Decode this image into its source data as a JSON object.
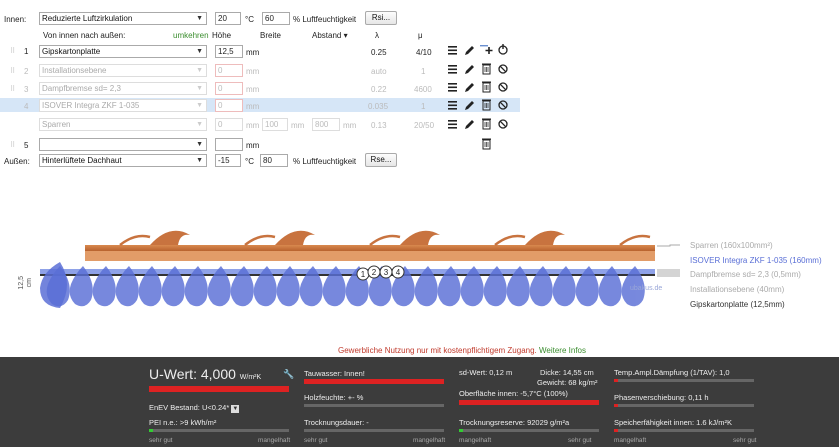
{
  "header": {
    "inside_label": "Innen:",
    "inside_climate": "Reduzierte Luftzirkulation",
    "inside_temp": "20",
    "temp_unit": "°C",
    "inside_humidity": "60",
    "humidity_label": "% Luftfeuchtigkeit",
    "rsi_button": "Rsi...",
    "order_label": "Von innen nach außen:",
    "reverse_link": "umkehren",
    "col_height": "Höhe",
    "col_width": "Breite",
    "col_spacing": "Abstand ▾",
    "col_lambda": "λ",
    "col_mu": "μ"
  },
  "layers": [
    {
      "num": "1",
      "material": "Gipskartonplatte",
      "height": "12,5",
      "unit": "mm",
      "lambda": "0.25",
      "mu": "4/10",
      "active": true
    },
    {
      "num": "2",
      "material": "Installationsebene",
      "height": "0",
      "unit": "mm",
      "lambda": "auto",
      "mu": "1",
      "active": false
    },
    {
      "num": "3",
      "material": "Dampfbremse sd= 2,3",
      "height": "0",
      "unit": "mm",
      "lambda": "0.22",
      "mu": "4600",
      "active": false
    },
    {
      "num": "4",
      "material": "ISOVER Integra ZKF 1-035",
      "height": "0",
      "unit": "mm",
      "lambda": "0.035",
      "mu": "1",
      "active": false
    },
    {
      "num": "",
      "material": "Sparren",
      "height": "0",
      "unit": "mm",
      "width": "100",
      "width_unit": "mm",
      "spacing": "800",
      "spacing_unit": "mm",
      "lambda": "0.13",
      "mu": "20/50",
      "active": false
    },
    {
      "num": "5",
      "material": "",
      "height": "",
      "unit": "mm",
      "lambda": "",
      "mu": "",
      "active": true
    }
  ],
  "outside": {
    "outside_label": "Außen:",
    "outside_climate": "Hinterlüftete Dachhaut",
    "outside_temp": "-15",
    "temp_unit": "°C",
    "outside_humidity": "80",
    "humidity_label": "% Luftfeuchtigkeit",
    "rse_button": "Rse..."
  },
  "diagram": {
    "scale_label": "12,5",
    "scale_unit": "cm",
    "markers": [
      "1",
      "2",
      "3",
      "4"
    ],
    "watermark": "ubakus.de",
    "legend": [
      {
        "text": "Sparren (160x100mm²)",
        "color": "#aaaaaa"
      },
      {
        "text": "ISOVER Integra ZKF 1-035 (160mm)",
        "color": "#5a6fd6"
      },
      {
        "text": "Dampfbremse sd= 2,3 (0,5mm)",
        "color": "#aaaaaa"
      },
      {
        "text": "Installationsebene (40mm)",
        "color": "#aaaaaa"
      },
      {
        "text": "Gipskartonplatte (12,5mm)",
        "color": "#333333"
      }
    ],
    "colors": {
      "roof": "#c8733f",
      "drop": "#5a6fd6",
      "accent": "#3a8d2e"
    }
  },
  "notice": {
    "text": "Gewerbliche Nutzung nur mit kostenpflichtigem Zugang.",
    "link": "Weitere Infos"
  },
  "results": {
    "uwert_label": "U-Wert:",
    "uwert_value": "4,000",
    "uwert_unit": "W/m²K",
    "enev_label": "EnEV Bestand: U<0.24*",
    "pei_label": "PEI n.e.: >9 kWh/m²",
    "scale_good": "sehr gut",
    "scale_bad": "mangelhaft",
    "tauwasser": "Tauwasser: Innen!",
    "holzfeuchte": "Holzfeuchte: +- %",
    "trocknungsdauer": "Trocknungsdauer: -",
    "sd_wert": "sd-Wert: 0,12 m",
    "dicke": "Dicke: 14,55 cm",
    "gewicht": "Gewicht: 68 kg/m²",
    "oberflaeche": "Oberfläche innen: -5,7°C (100%)",
    "trocknungsreserve": "Trocknungsreserve: 92029 g/m²a",
    "temp_amp": "Temp.Ampl.Dämpfung (1/TAV): 1,0",
    "phasen": "Phasenverschiebung: 0,11 h",
    "speicher": "Speicherfähigkeit innen: 1.6 kJ/m²K"
  }
}
